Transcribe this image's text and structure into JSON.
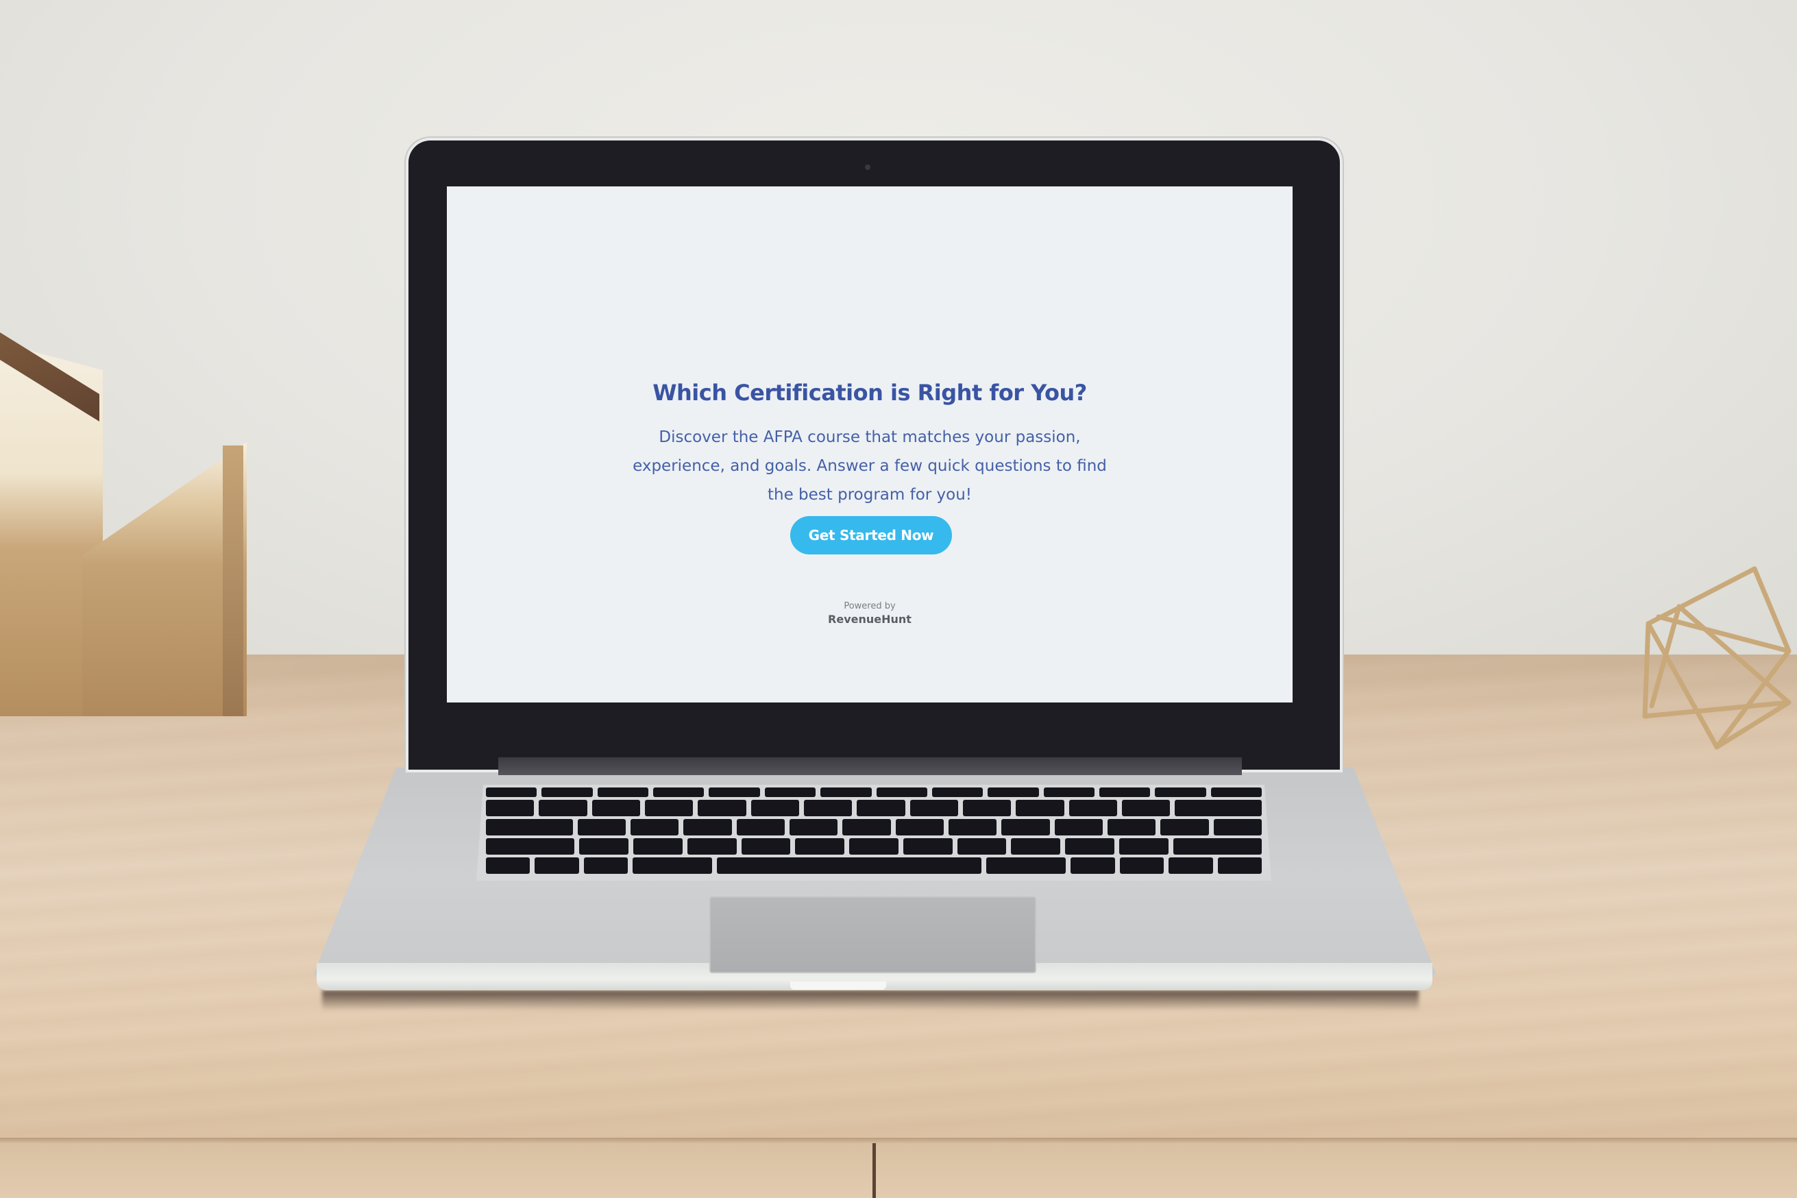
{
  "quiz": {
    "title": "Which Certification is Right for You?",
    "description": "Discover the AFPA course that matches your passion, experience, and goals. Answer a few quick questions to find the best program for you!",
    "cta_label": "Get Started Now",
    "powered_by_label": "Powered by",
    "brand_name": "RevenueHunt"
  },
  "colors": {
    "title": "#3a54a3",
    "body_text": "#4560a8",
    "cta_background": "#36b9ec",
    "cta_text": "#ffffff",
    "screen_background": "#edf1f4"
  }
}
